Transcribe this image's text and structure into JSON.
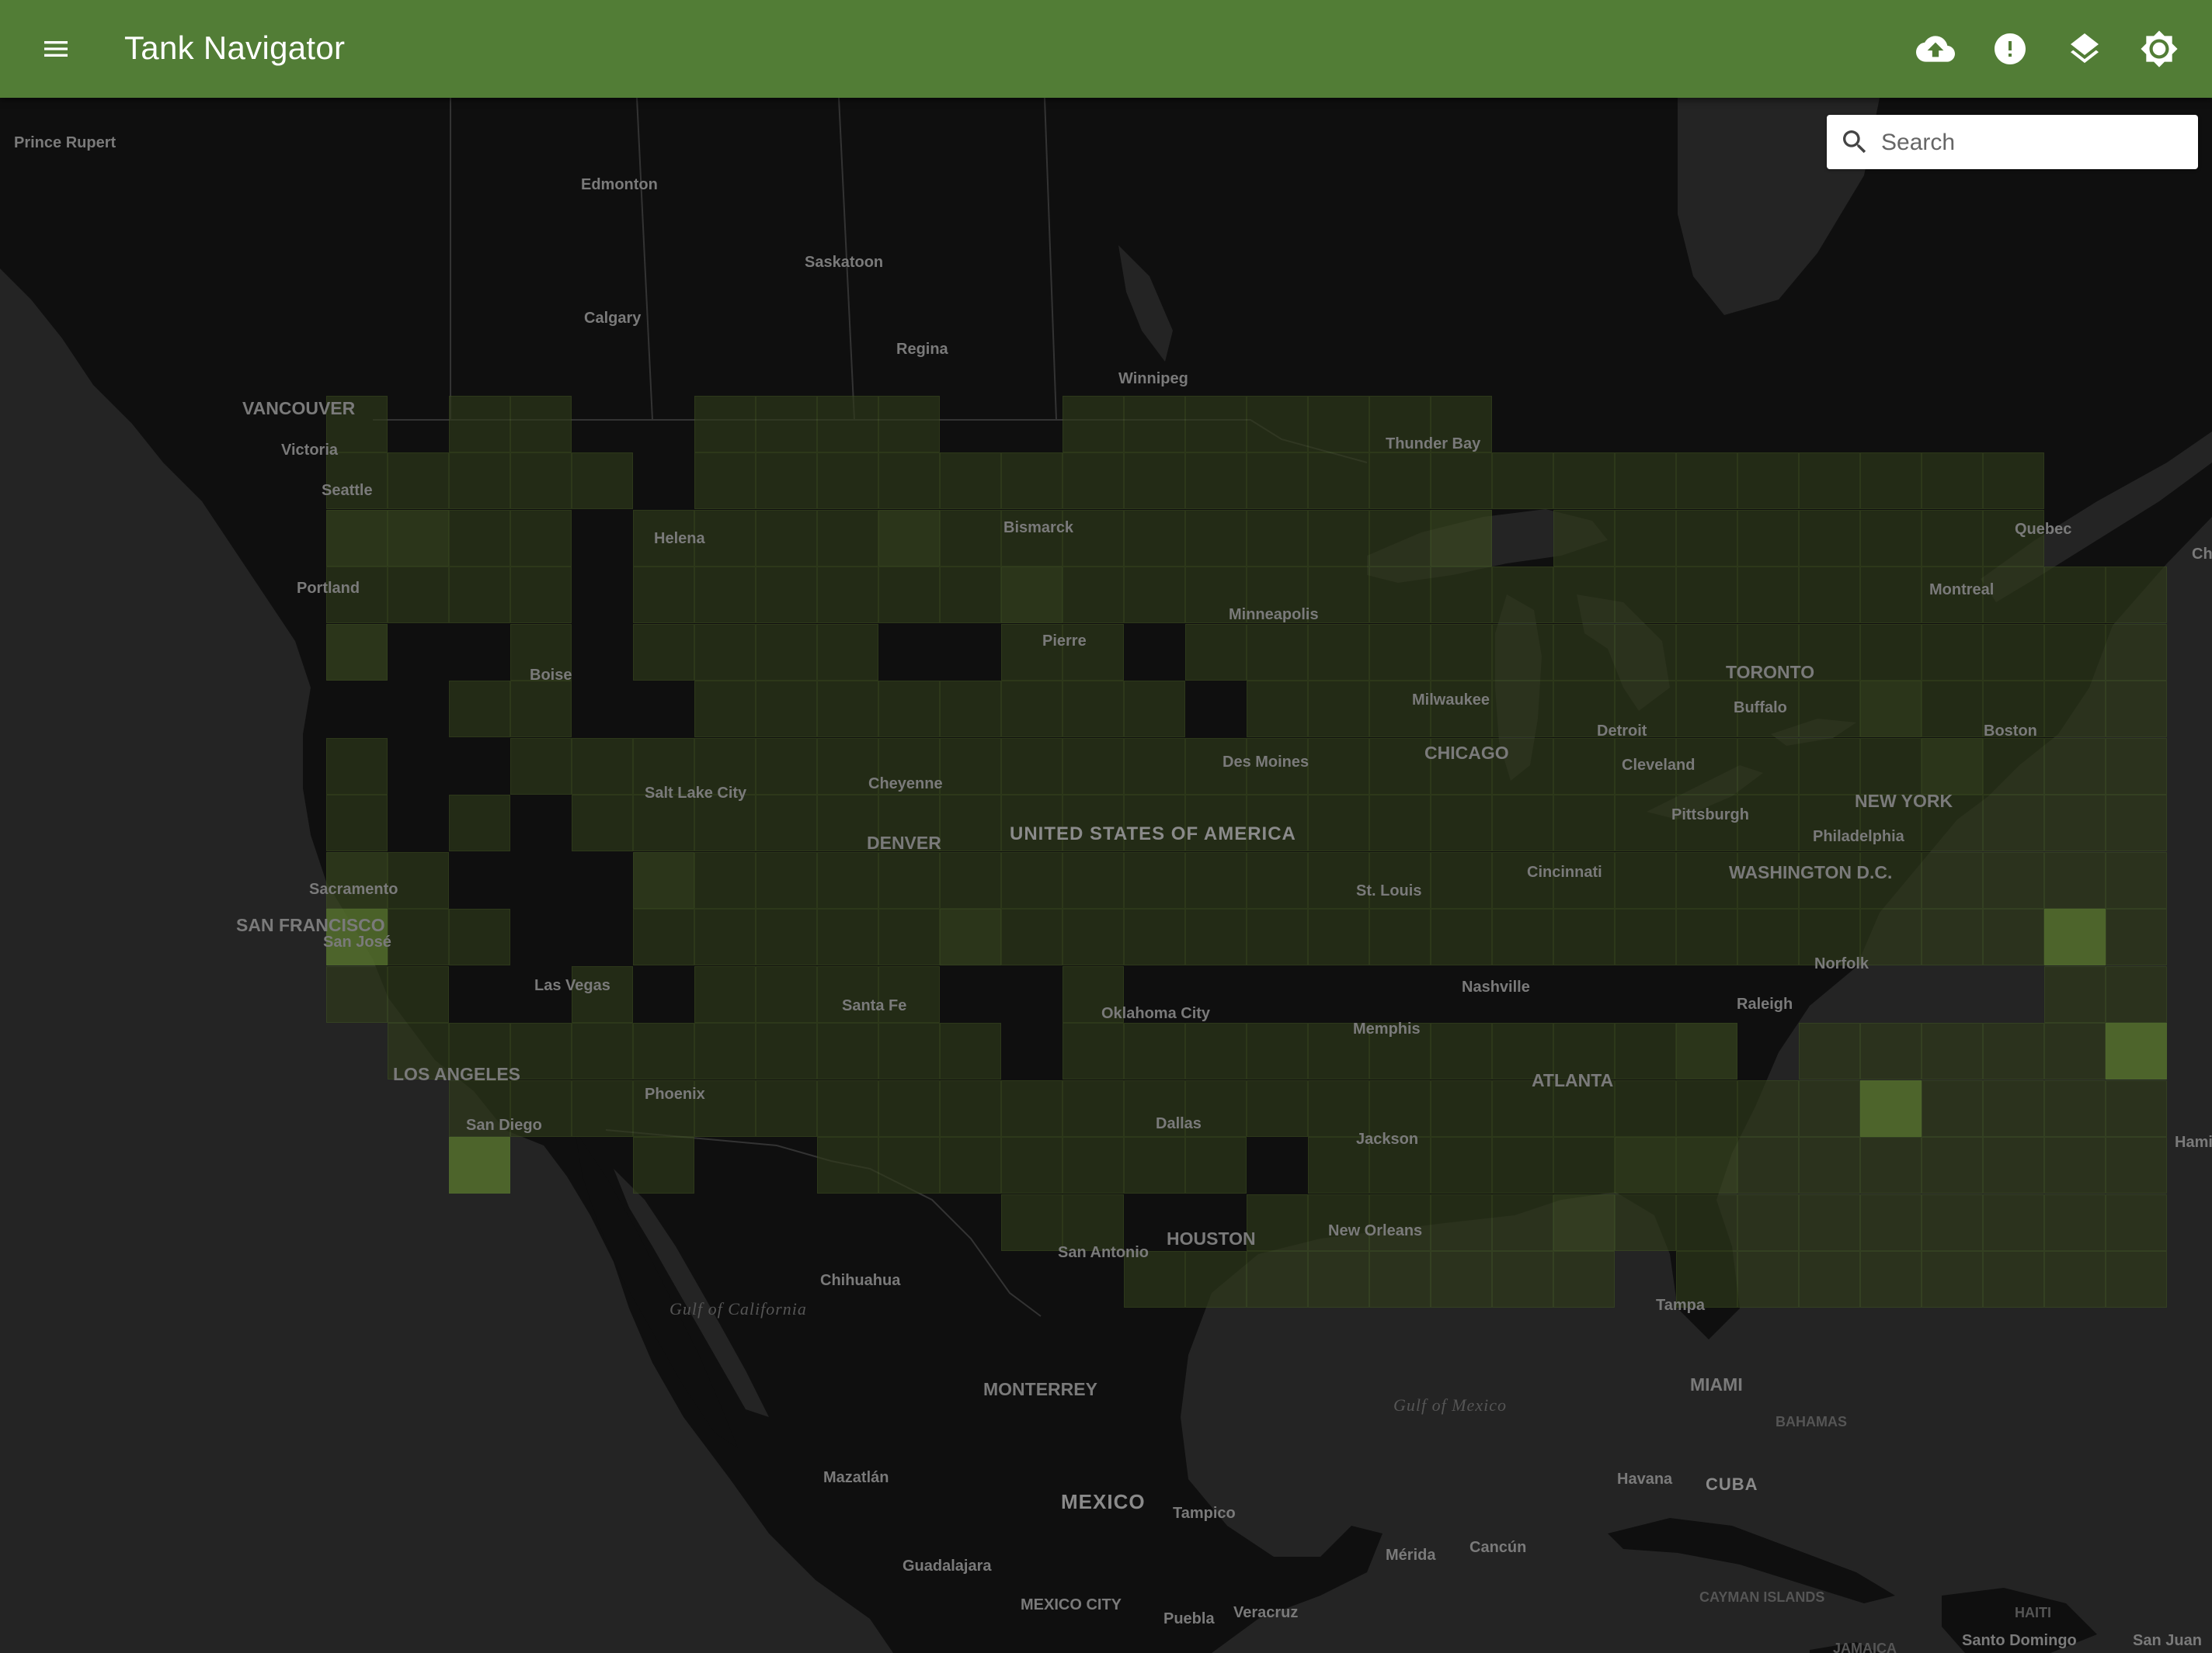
{
  "app": {
    "title": "Tank Navigator"
  },
  "toolbar": {
    "menu_icon": "menu-icon",
    "actions": [
      {
        "name": "upload-button",
        "icon": "cloud-upload-icon"
      },
      {
        "name": "alert-button",
        "icon": "alert-circle-icon"
      },
      {
        "name": "layers-button",
        "icon": "layers-icon"
      },
      {
        "name": "brightness-button",
        "icon": "brightness-icon"
      }
    ]
  },
  "search": {
    "placeholder": "Search",
    "value": ""
  },
  "colors": {
    "appbar": "#527d36",
    "land": "#0f0f0f",
    "water": "#242424",
    "heat_low": "#2a3318",
    "heat_high": "#8cb04e"
  },
  "map": {
    "labels": {
      "prince_rupert": "Prince Rupert",
      "edmonton": "Edmonton",
      "saskatoon": "Saskatoon",
      "calgary": "Calgary",
      "regina": "Regina",
      "winnipeg": "Winnipeg",
      "thunder_bay": "Thunder Bay",
      "vancouver": "VANCOUVER",
      "victoria": "Victoria",
      "seattle": "Seattle",
      "portland": "Portland",
      "helena": "Helena",
      "bismarck": "Bismarck",
      "boise": "Boise",
      "pierre": "Pierre",
      "minneapolis": "Minneapolis",
      "quebec": "Quebec",
      "montreal": "Montreal",
      "toronto": "TORONTO",
      "buffalo": "Buffalo",
      "boston": "Boston",
      "milwaukee": "Milwaukee",
      "detroit": "Detroit",
      "chicago": "CHICAGO",
      "cleveland": "Cleveland",
      "des_moines": "Des Moines",
      "salt_lake_city": "Salt Lake City",
      "cheyenne": "Cheyenne",
      "usa": "UNITED STATES OF AMERICA",
      "denver": "DENVER",
      "pittsburgh": "Pittsburgh",
      "new_york": "NEW YORK",
      "philadelphia": "Philadelphia",
      "washington": "WASHINGTON D.C.",
      "sacramento": "Sacramento",
      "san_francisco": "SAN FRANCISCO",
      "san_jose": "San José",
      "st_louis": "St. Louis",
      "cincinnati": "Cincinnati",
      "norfolk": "Norfolk",
      "las_vegas": "Las Vegas",
      "santa_fe": "Santa Fe",
      "oklahoma_city": "Oklahoma City",
      "nashville": "Nashville",
      "raleigh": "Raleigh",
      "memphis": "Memphis",
      "los_angeles": "LOS ANGELES",
      "san_diego": "San Diego",
      "phoenix": "Phoenix",
      "dallas": "Dallas",
      "atlanta": "ATLANTA",
      "jackson": "Jackson",
      "houston": "HOUSTON",
      "san_antonio": "San Antonio",
      "new_orleans": "New Orleans",
      "chihuahua": "Chihuahua",
      "gulf_california": "Gulf of California",
      "tampa": "Tampa",
      "miami": "MIAMI",
      "monterrey": "MONTERREY",
      "gulf_mexico": "Gulf of Mexico",
      "bahamas": "BAHAMAS",
      "mazatlan": "Mazatlán",
      "havana": "Havana",
      "cuba": "CUBA",
      "mexico": "MEXICO",
      "tampico": "Tampico",
      "merida": "Mérida",
      "cancun": "Cancún",
      "guadalajara": "Guadalajara",
      "cayman": "CAYMAN ISLANDS",
      "mexico_city": "MEXICO CITY",
      "puebla": "Puebla",
      "veracruz": "Veracruz",
      "haiti": "HAITI",
      "santo_domingo": "Santo Domingo",
      "san_juan": "San Juan",
      "jamaica": "JAMAICA",
      "hamilton": "Hami",
      "chi": "Chi"
    }
  }
}
